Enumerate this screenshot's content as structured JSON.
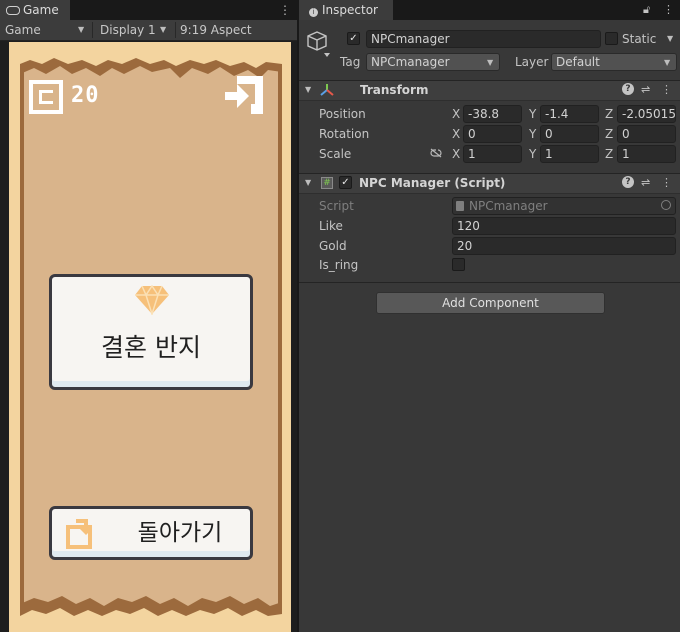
{
  "game_window": {
    "tab_label": "Game",
    "toolbar": {
      "mode": "Game",
      "display": "Display 1",
      "aspect": "9:19 Aspect"
    },
    "hud": {
      "gold_value": "20"
    },
    "buttons": {
      "ring_label": "결혼 반지",
      "back_label": "돌아가기"
    }
  },
  "inspector": {
    "tab_label": "Inspector",
    "object": {
      "name": "NPCmanager",
      "static_label": "Static",
      "tag_label": "Tag",
      "tag_value": "NPCmanager",
      "layer_label": "Layer",
      "layer_value": "Default"
    },
    "transform": {
      "title": "Transform",
      "rows": [
        {
          "label": "Position",
          "x": "-38.8",
          "y": "-1.4",
          "z": "-2.05015"
        },
        {
          "label": "Rotation",
          "x": "0",
          "y": "0",
          "z": "0"
        },
        {
          "label": "Scale",
          "x": "1",
          "y": "1",
          "z": "1"
        }
      ],
      "axis": {
        "x": "X",
        "y": "Y",
        "z": "Z"
      }
    },
    "script_component": {
      "title": "NPC Manager (Script)",
      "script_label": "Script",
      "script_value": "NPCmanager",
      "like_label": "Like",
      "like_value": "120",
      "gold_label": "Gold",
      "gold_value": "20",
      "is_ring_label": "Is_ring",
      "is_ring_checked": false
    },
    "add_component_label": "Add Component"
  },
  "colors": {
    "editor_bg": "#282828",
    "panel_bg": "#383838",
    "paper": "#d9b48b",
    "card": "#f7f5f2",
    "diamond": "#f6c07a"
  }
}
